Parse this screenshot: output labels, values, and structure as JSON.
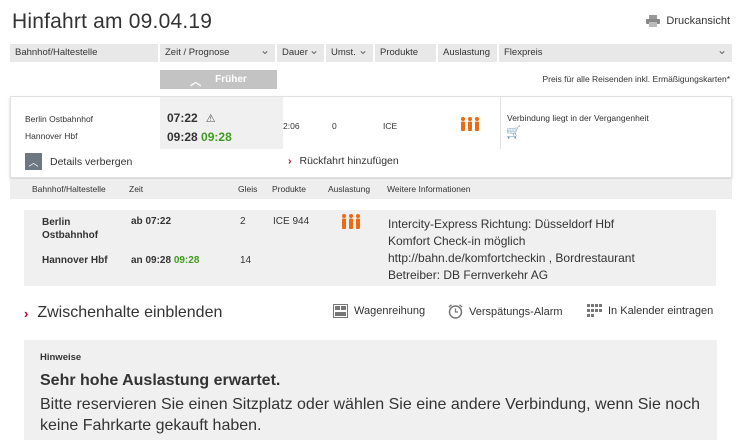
{
  "header": {
    "title": "Hinfahrt am 09.04.19",
    "print_label": "Druckansicht"
  },
  "columns": [
    "Bahnhof/Haltestelle",
    "Zeit / Prognose",
    "Dauer",
    "Umst.",
    "Produkte",
    "Auslastung",
    "Flexpreis"
  ],
  "earlier_label": "Früher",
  "price_note": "Preis für alle Reisenden inkl. Ermäßigungskarten*",
  "connection": {
    "from": "Berlin Ostbahnhof",
    "to": "Hannover Hbf",
    "dep_time": "07:22",
    "arr_time": "09:28",
    "arr_realtime": "09:28",
    "duration": "2:06",
    "changes": "0",
    "product": "ICE",
    "flex_info": "Verbindung liegt in der Vergangenheit",
    "hide_details": "Details verbergen",
    "return_trip": "Rückfahrt hinzufügen"
  },
  "detail_columns": [
    "Bahnhof/Haltestelle",
    "Zeit",
    "Gleis",
    "Produkte",
    "Auslastung",
    "Weitere Informationen"
  ],
  "detail": {
    "from": "Berlin Ostbahnhof",
    "to": "Hannover Hbf",
    "dep_label": "ab 07:22",
    "arr_label": "an 09:28",
    "arr_realtime": "09:28",
    "dep_track": "2",
    "arr_track": "14",
    "product": "ICE 944",
    "info": [
      "Intercity-Express Richtung: Düsseldorf Hbf",
      "Komfort Check-in möglich",
      "http://bahn.de/komfortcheckin , Bordrestaurant",
      "Betreiber: DB Fernverkehr AG"
    ]
  },
  "actions": {
    "stops": "Zwischenhalte einblenden",
    "wagon": "Wagenreihung",
    "delay_alarm": "Verspätungs-Alarm",
    "calendar": "In Kalender eintragen"
  },
  "notice": {
    "heading": "Hinweise",
    "title": "Sehr hohe Auslastung erwartet.",
    "body": "Bitte reservieren Sie einen Sitzplatz oder wählen Sie eine andere Verbindung, wenn Sie noch keine Fahrkarte gekauft haben."
  },
  "colors": {
    "accent_red": "#b7002a",
    "realtime_green": "#3f9b1f",
    "load_orange": "#ec6b12"
  },
  "icons": [
    "printer-icon",
    "warning-icon",
    "occupancy-icon",
    "cart-icon",
    "chevron-up-icon",
    "chevron-right-icon",
    "wagon-icon",
    "alarm-clock-icon",
    "calendar-icon"
  ]
}
